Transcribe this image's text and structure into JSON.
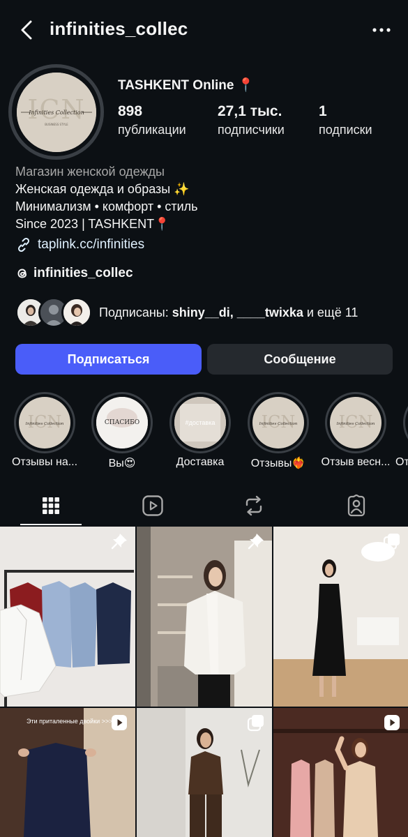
{
  "header": {
    "username": "infinities_collec"
  },
  "avatar": {
    "monogram": "ICN",
    "brand": "Infinities Collection"
  },
  "profile": {
    "city_line": "TASHKENT  Online 📍",
    "stats": [
      {
        "value": "898",
        "label": "публикации"
      },
      {
        "value": "27,1 тыс.",
        "label": "подписчики"
      },
      {
        "value": "1",
        "label": "подписки"
      }
    ],
    "category": "Магазин женской одежды",
    "bio_lines": [
      "Женская одежда и образы ✨",
      "Минимализм • комфорт • стиль",
      "Since 2023 | TASHKENT📍"
    ],
    "link": "taplink.cc/infinities",
    "threads_handle": "infinities_collec"
  },
  "followed_by": {
    "prefix": "Подписаны: ",
    "names": "shiny__di, ____twixka",
    "suffix": " и ещё 11"
  },
  "buttons": {
    "follow": "Подписаться",
    "message": "Сообщение"
  },
  "highlights": [
    {
      "label": "Отзывы на..."
    },
    {
      "label": "Вы😍"
    },
    {
      "label": "Доставка"
    },
    {
      "label": "Отзывы❤️‍🔥"
    },
    {
      "label": "Отзыв весн..."
    },
    {
      "label": "От"
    }
  ],
  "highlight_texts": {
    "thanks": "СПАСИБО",
    "delivery": "#доставка"
  },
  "posts": [
    {
      "badge": "pin",
      "caption": ""
    },
    {
      "badge": "pin",
      "caption": ""
    },
    {
      "badge": "carousel",
      "caption": ""
    },
    {
      "badge": "reel",
      "caption": "Эти приталенные двойки >>>"
    },
    {
      "badge": "carousel",
      "caption": ""
    },
    {
      "badge": "reel",
      "caption": ""
    }
  ],
  "colors": {
    "background": "#0c1014",
    "accent": "#4a5df9",
    "secondary_button": "#25292e"
  }
}
